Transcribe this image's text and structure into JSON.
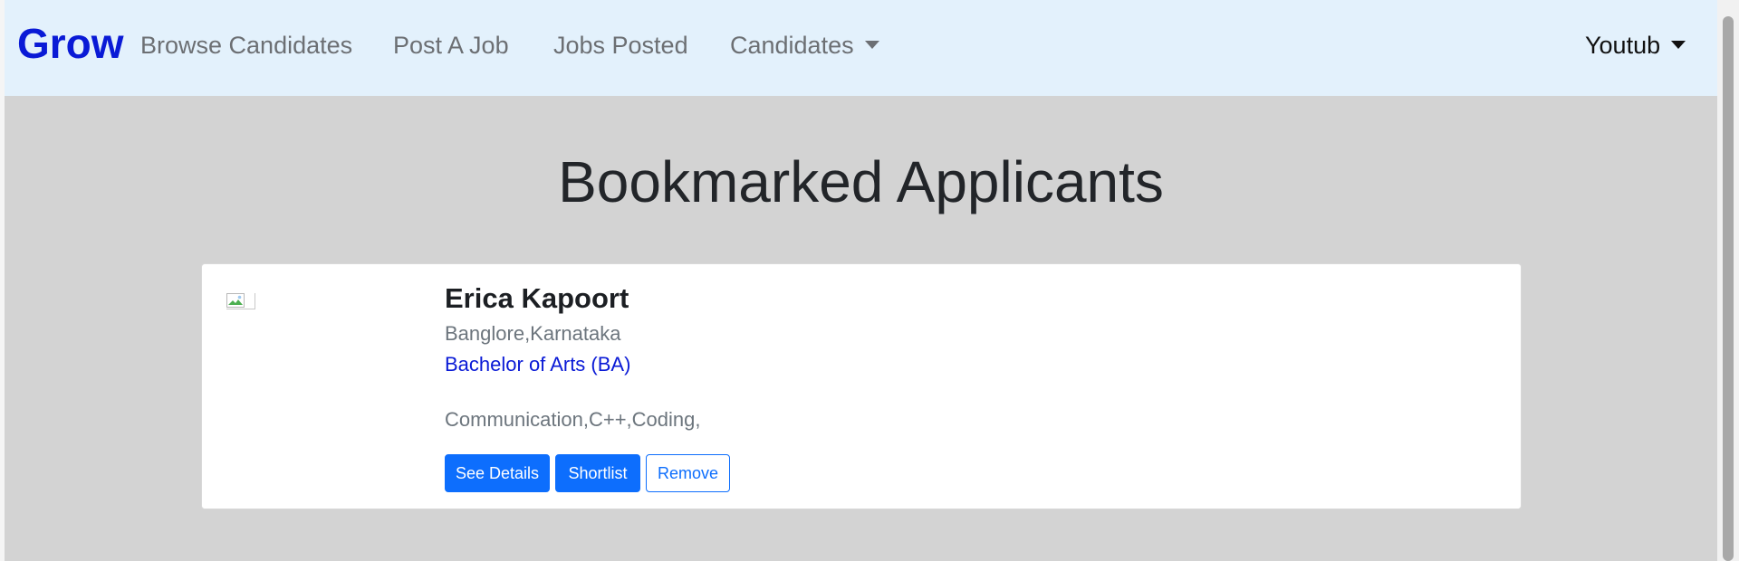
{
  "navbar": {
    "brand": "Grow",
    "links": [
      "Browse Candidates",
      "Post A Job",
      "Jobs Posted",
      "Candidates"
    ],
    "user": "Youtub",
    "background": "#e3f1fc",
    "brand_color": "#0a1ad6"
  },
  "page": {
    "title": "Bookmarked Applicants",
    "background": "#d3d3d3"
  },
  "applicant": {
    "avatar_icon": "broken-image-icon",
    "name": "Erica Kapoort",
    "location": "Banglore,Karnataka",
    "degree": "Bachelor of Arts (BA)",
    "skills": "Communication,C++,Coding,"
  },
  "actions": {
    "see_details": "See Details",
    "shortlist": "Shortlist",
    "remove": "Remove",
    "primary_color": "#0d6efd"
  }
}
